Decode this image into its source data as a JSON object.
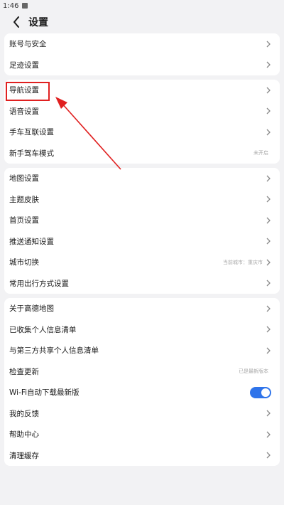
{
  "status_bar": {
    "time": "1:46"
  },
  "header": {
    "title": "设置"
  },
  "groups": [
    {
      "items": [
        {
          "label": "账号与安全"
        },
        {
          "label": "足迹设置"
        }
      ]
    },
    {
      "items": [
        {
          "label": "导航设置"
        },
        {
          "label": "语音设置"
        },
        {
          "label": "手车互联设置"
        },
        {
          "label": "新手驾车模式",
          "hint": "未开启"
        }
      ]
    },
    {
      "items": [
        {
          "label": "地图设置"
        },
        {
          "label": "主题皮肤"
        },
        {
          "label": "首页设置"
        },
        {
          "label": "推送通知设置"
        },
        {
          "label": "城市切换",
          "hint": "当前城市：重庆市"
        },
        {
          "label": "常用出行方式设置"
        }
      ]
    },
    {
      "items": [
        {
          "label": "关于高德地图"
        },
        {
          "label": "已收集个人信息清单"
        },
        {
          "label": "与第三方共享个人信息清单"
        },
        {
          "label": "检查更新",
          "hint": "已是最新版本"
        },
        {
          "label": "Wi-Fi自动下载最新版",
          "toggle_on": true
        },
        {
          "label": "我的反馈"
        },
        {
          "label": "帮助中心"
        },
        {
          "label": "清理缓存"
        }
      ]
    }
  ],
  "colors": {
    "toggle_on": "#2f74ea",
    "annotation_red": "#e02020",
    "background": "#f2f2f4"
  },
  "icons": {
    "back": "chevron-left-icon",
    "row": "chevron-right-icon"
  }
}
